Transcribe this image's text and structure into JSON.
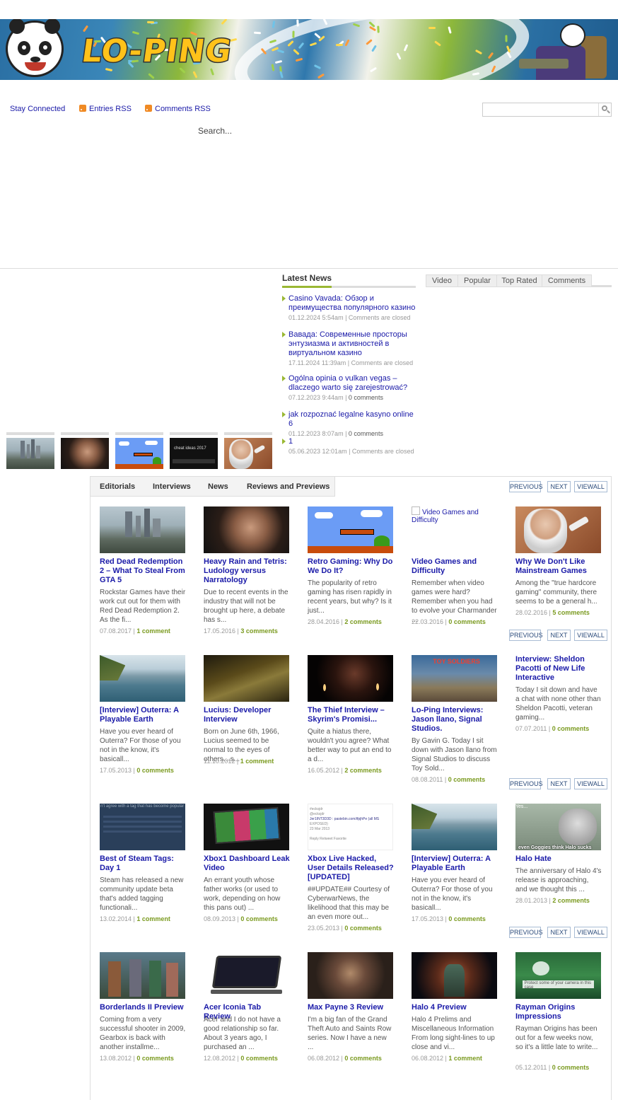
{
  "brand": {
    "logo_text": "LO-PING"
  },
  "topbar": {
    "stay_connected": "Stay Connected",
    "entries_rss": "Entries RSS",
    "comments_rss": "Comments RSS",
    "search_placeholder": "",
    "search_label": "Search..."
  },
  "latest_news": {
    "heading": "Latest News",
    "items": [
      {
        "title": "Casino Vavada: Обзор и преимущества популярного казино",
        "date": "01.12.2024 5:54am",
        "comments": "Comments are closed",
        "closed": true
      },
      {
        "title": "Вавада: Современные просторы энтузиазма и активностей в виртуальном казино",
        "date": "17.11.2024 11:39am",
        "comments": "Comments are closed",
        "closed": true
      },
      {
        "title": "Ogólna opinia o vulkan vegas – dlaczego warto się zarejestrować?",
        "date": "07.12.2023 9:44am",
        "comments": "0 comments",
        "closed": false
      },
      {
        "title": "jak rozpoznać legalne kasyno online 6",
        "date": "01.12.2023 8:07am",
        "comments": "0 comments",
        "closed": false
      },
      {
        "title": "1",
        "date": "05.06.2023 12:01am",
        "comments": "Comments are closed",
        "closed": true
      }
    ]
  },
  "side_tabs": [
    "Video",
    "Popular",
    "Top Rated",
    "Comments"
  ],
  "main_tabs": [
    "Editorials",
    "Interviews",
    "News",
    "Reviews and Previews"
  ],
  "nav": {
    "previous": "PREVIOUS",
    "next": "NEXT",
    "viewall": "VIEWALL"
  },
  "rows": [
    [
      {
        "title": "Red Dead Redemption 2 – What To Steal From GTA 5",
        "excerpt": "Rockstar Games have their work cut out for them with Red Dead Redemption 2. As the fi...",
        "date": "07.08.2017",
        "comments": "1 comment",
        "thumb": "city"
      },
      {
        "title": "Heavy Rain and Tetris: Ludology versus Narratology",
        "excerpt": "Due to recent events in the industry that will not be brought up here, a debate has s...",
        "date": "17.05.2016",
        "comments": "3 comments",
        "thumb": "face"
      },
      {
        "title": "Retro Gaming: Why Do We Do It?",
        "excerpt": "The popularity of retro gaming has risen rapidly in recent years, but why? Is it just...",
        "date": "28.04.2016",
        "comments": "2 comments",
        "thumb": "mario"
      },
      {
        "title": "Video Games and Difficulty",
        "excerpt": "Remember when video games were hard? Remember when you had to evolve your Charmander ...",
        "date": "22.03.2016",
        "comments": "0 comments",
        "thumb": "broken",
        "alt": "Video Games and Difficulty"
      },
      {
        "title": "Why We Don't Like Mainstream Games",
        "excerpt": "Among the \"true hardcore gaming\" community, there seems to be a general h...",
        "date": "28.02.2016",
        "comments": "5 comments",
        "thumb": "granny"
      }
    ],
    [
      {
        "title": "[Interview] Outerra: A Playable Earth",
        "excerpt": "Have you ever heard of Outerra? For those of you not in the know, it's basicall...",
        "date": "17.05.2013",
        "comments": "0 comments",
        "thumb": "coast"
      },
      {
        "title": "Lucius: Developer Interview",
        "excerpt": "Born on June 6th, 1966, Lucius seemed to be normal to the eyes of others…s...",
        "date": "11.10.2012",
        "comments": "1 comment",
        "thumb": "forest"
      },
      {
        "title": "The Thief Interview – Skyrim's Promisi...",
        "excerpt": "Quite a hiatus there, wouldn't you agree?  What better way to put an end to a d...",
        "date": "16.05.2012",
        "comments": "2 comments",
        "thumb": "candle"
      },
      {
        "title": "Lo-Ping Interviews: Jason llano, Signal Studios.",
        "excerpt": "By Gavin G. Today I sit down with Jason llano from Signal Studios to discuss Toy Sold...",
        "date": "08.08.2011",
        "comments": "0 comments",
        "thumb": "toysoldiers",
        "thumb_text": "TOY SOLDIERS"
      },
      {
        "title": "Interview: Sheldon Pacotti of New Life Interactive",
        "excerpt": "Today I sit down and have a chat with none other than Sheldon Pacotti, veteran gaming...",
        "date": "07.07.2011",
        "comments": "0 comments",
        "thumb": "none"
      }
    ],
    [
      {
        "title": "Best of Steam Tags: Day 1",
        "excerpt": "Steam has released a new community update beta that's added tagging functionali...",
        "date": "13.02.2014",
        "comments": "1 comment",
        "thumb": "steam",
        "thumb_text": "n't agree with a tag that has become popular"
      },
      {
        "title": "Xbox1 Dashboard Leak Video",
        "excerpt": "An errant youth whose father works (or used to work, depending on how this pans out) ...",
        "date": "08.09.2013",
        "comments": "0 comments",
        "thumb": "xbox"
      },
      {
        "title": "Xbox Live Hacked, User Details Released? [UPDATED]",
        "excerpt": "##UPDATE## Courtesy of CyberwarNews, the likelihood that this may be an even more out...",
        "date": "23.05.2013",
        "comments": "0 comments",
        "thumb": "tweet",
        "thumb_lines": [
          "#ecksjdr",
          "@ecksjdr",
          "Jer1INT3D3D : pastebin.com/ifpjhPe (all MS",
          "EXPOSED)",
          "23 Mar 2013",
          "",
          "Reply  Retweet  Favorite"
        ]
      },
      {
        "title": "[Interview] Outerra: A Playable Earth",
        "excerpt": "Have you ever heard of Outerra? For those of you not in the know, it's basicall...",
        "date": "17.05.2013",
        "comments": "0 comments",
        "thumb": "coast"
      },
      {
        "title": "Halo Hate",
        "excerpt": " The anniversary of Halo 4's release is approaching, and we thought this ...",
        "date": "28.01.2013",
        "comments": "2 comments",
        "thumb": "halo",
        "thumb_text": "even Goggies think Halo sucks",
        "thumb_text2": "Yes..."
      }
    ],
    [
      {
        "title": "Borderlands II Preview",
        "excerpt": "Coming from a very successful shooter in 2009, Gearbox is back with another installme...",
        "date": "13.08.2012",
        "comments": "0 comments",
        "thumb": "borderlands"
      },
      {
        "title": "Acer Iconia Tab Review",
        "excerpt": "Acer and I do not have a good relationship so far. About 3 years ago, I purchased an ...",
        "date": "12.08.2012",
        "comments": "0 comments",
        "thumb": "tablet"
      },
      {
        "title": "Max Payne 3 Review",
        "excerpt": "I'm a big fan of the Grand Theft Auto and Saints Row series.  Now I have a new ...",
        "date": "06.08.2012",
        "comments": "0 comments",
        "thumb": "payne"
      },
      {
        "title": "Halo 4 Preview",
        "excerpt": "Halo 4 Prelims and Miscellaneous Information From long sight-lines to up close and vi...",
        "date": "06.08.2012",
        "comments": "1 comment",
        "thumb": "halo4"
      },
      {
        "title": "Rayman Origins Impressions",
        "excerpt": "Rayman Origins has been out for a few weeks now, so it's a little late to write...",
        "date": "05.12.2011",
        "comments": "0 comments",
        "thumb": "rayman",
        "thumb_text": "Protect some of your camera in this case"
      }
    ]
  ],
  "colors": {
    "link": "#1a1aa8",
    "accent": "#9ab833",
    "comment": "#7a9a1f"
  }
}
